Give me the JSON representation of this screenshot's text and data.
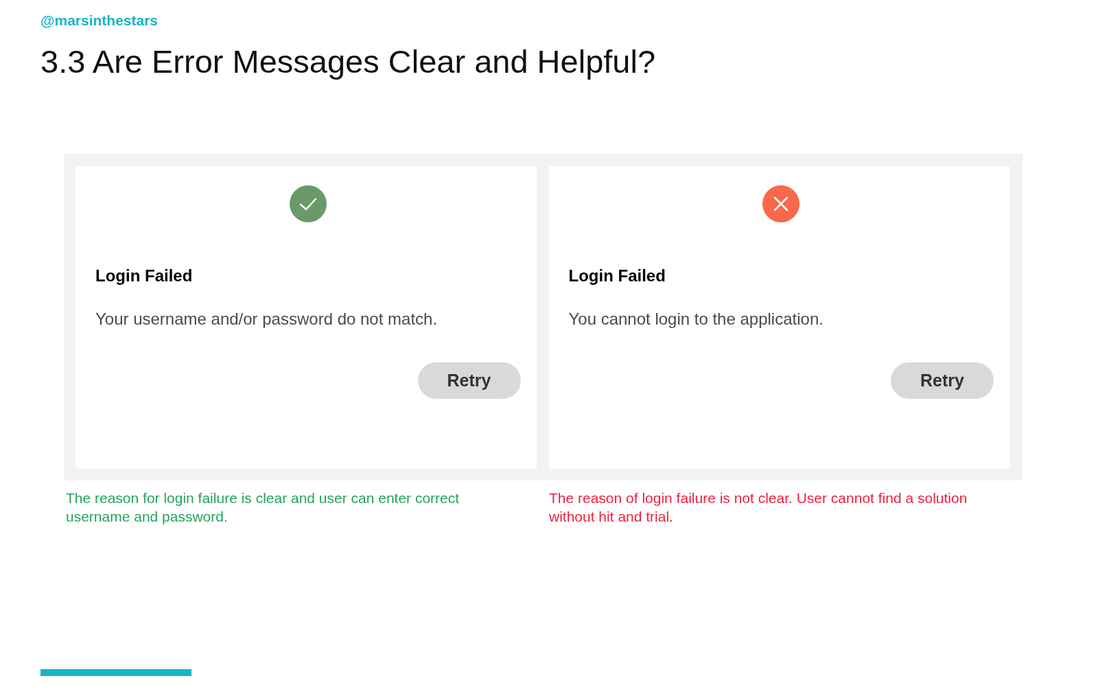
{
  "handle": "@marsinthestars",
  "title": "3.3 Are Error Messages Clear and Helpful?",
  "examples": [
    {
      "kind": "success",
      "color": "#6a9a6a",
      "heading": "Login Failed",
      "message": "Your username and/or password do not match.",
      "button": "Retry",
      "caption": "The reason for login failure is clear and user can enter correct username and password."
    },
    {
      "kind": "error",
      "color": "#f7694a",
      "heading": "Login Failed",
      "message": "You cannot login to the application.",
      "button": "Retry",
      "caption": "The reason of login failure is not clear. User cannot find a solution without hit and trial."
    }
  ]
}
